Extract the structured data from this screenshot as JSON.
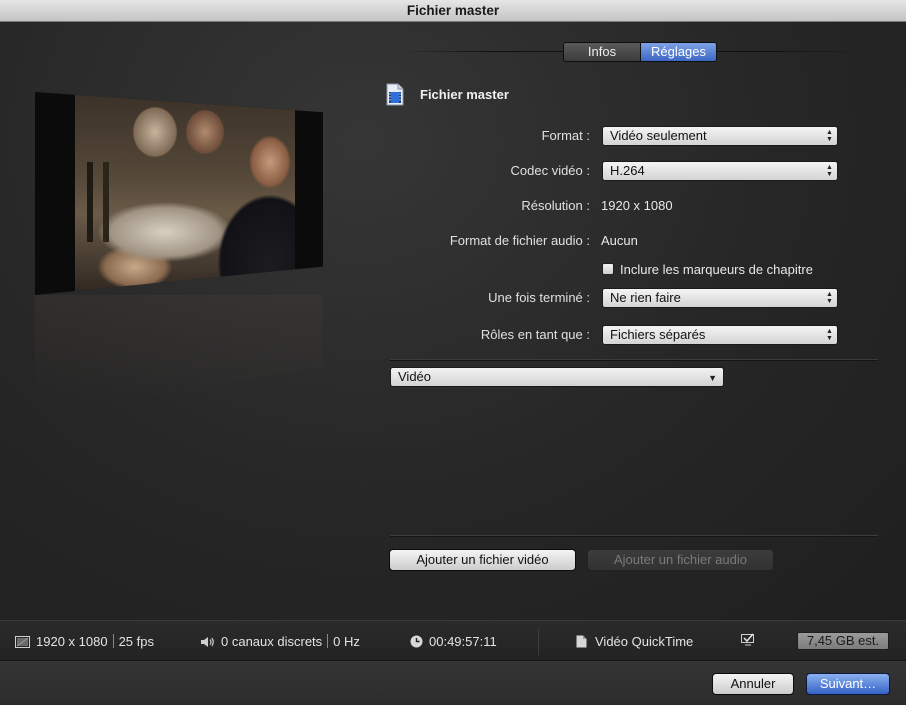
{
  "window": {
    "title": "Fichier master"
  },
  "tabs": [
    {
      "label": "Infos",
      "active": false
    },
    {
      "label": "Réglages",
      "active": true
    }
  ],
  "header": {
    "title": "Fichier master",
    "icon": "movie-document-icon"
  },
  "settings": {
    "format": {
      "label": "Format :",
      "value": "Vidéo seulement"
    },
    "codec": {
      "label": "Codec vidéo :",
      "value": "H.264"
    },
    "resolution": {
      "label": "Résolution :",
      "value": "1920 x 1080"
    },
    "audio_format": {
      "label": "Format de fichier audio :",
      "value": "Aucun"
    },
    "chapters": {
      "label": "Inclure les marqueurs de chapitre",
      "checked": false
    },
    "when_done": {
      "label": "Une fois terminé :",
      "value": "Ne rien faire"
    },
    "roles": {
      "label": "Rôles en tant que :",
      "value": "Fichiers séparés"
    }
  },
  "section": {
    "value": "Vidéo"
  },
  "buttons": {
    "add_video": "Ajouter un fichier vidéo",
    "add_audio": "Ajouter un fichier audio",
    "cancel": "Annuler",
    "next": "Suivant…"
  },
  "status": {
    "resolution": "1920 x 1080",
    "fps": "25 fps",
    "audio_channels": "0 canaux discrets",
    "sample_rate": "0 Hz",
    "duration": "00:49:57:11",
    "file_type": "Vidéo QuickTime",
    "estimated_size": "7,45 GB est."
  },
  "colors": {
    "accent": "#3d66c4",
    "background": "#262626"
  }
}
